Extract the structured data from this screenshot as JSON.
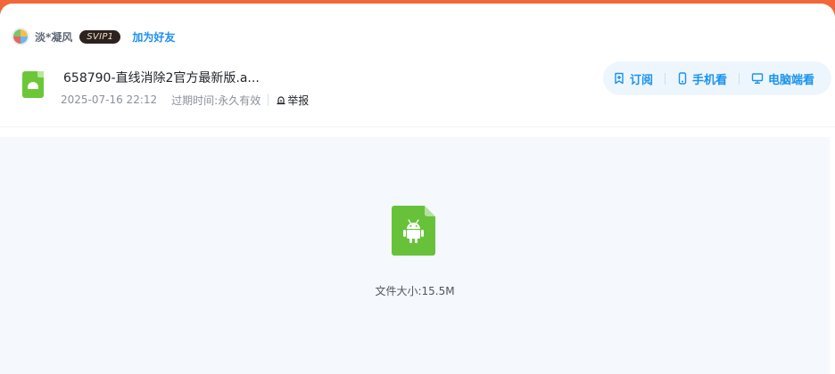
{
  "user": {
    "name": "淡*凝风",
    "vip_badge": "SVIP1",
    "add_friend_label": "加为好友"
  },
  "file": {
    "title": "658790-直线消除2官方最新版.a...",
    "date": "2025-07-16 22:12",
    "expiry_label": "过期时间:",
    "expiry_value": "永久有效",
    "report_label": "举报",
    "size_text": "文件大小:15.5M",
    "type_icon": "android-apk-file-icon"
  },
  "actions": {
    "subscribe_label": "订阅",
    "mobile_label": "手机看",
    "desktop_label": "电脑端看"
  },
  "colors": {
    "header_accent": "#f0673a",
    "link_blue": "#1b8ff0",
    "file_green": "#67c23a",
    "preview_bg": "#f5f8fc"
  }
}
